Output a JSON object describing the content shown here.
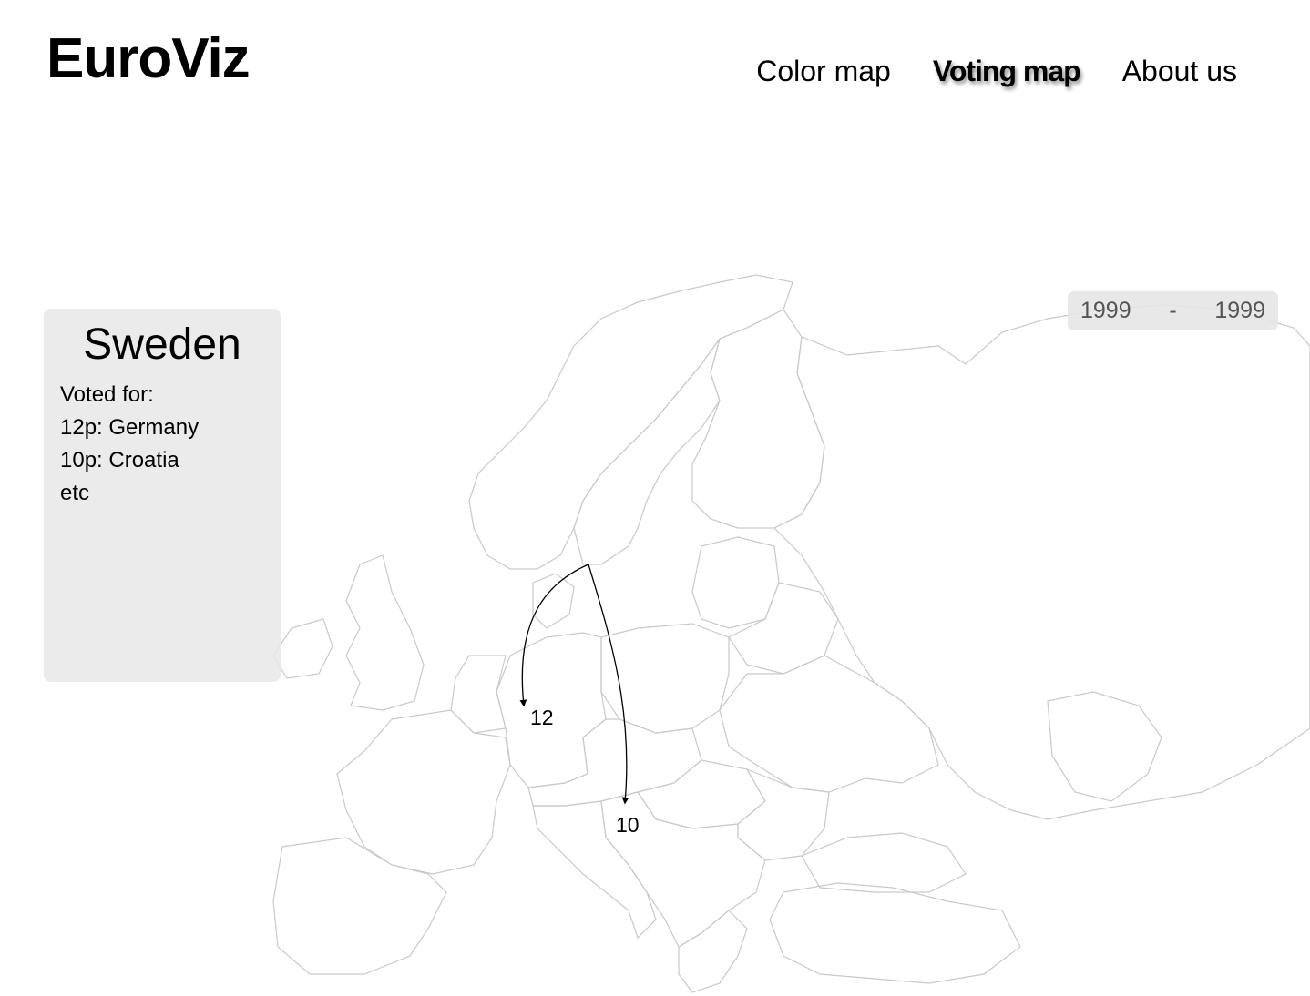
{
  "header": {
    "logo": "EuroViz",
    "nav": [
      {
        "label": "Color map",
        "active": false
      },
      {
        "label": "Voting map",
        "active": true
      },
      {
        "label": "About us",
        "active": false
      }
    ]
  },
  "info_panel": {
    "country": "Sweden",
    "lines": [
      "Voted for:",
      "12p: Germany",
      "10p: Croatia",
      "etc"
    ]
  },
  "year_range": {
    "from": "1999",
    "separator": "-",
    "to": "1999"
  },
  "map": {
    "votes": [
      {
        "points": "12",
        "to": "Germany"
      },
      {
        "points": "10",
        "to": "Croatia"
      }
    ]
  }
}
